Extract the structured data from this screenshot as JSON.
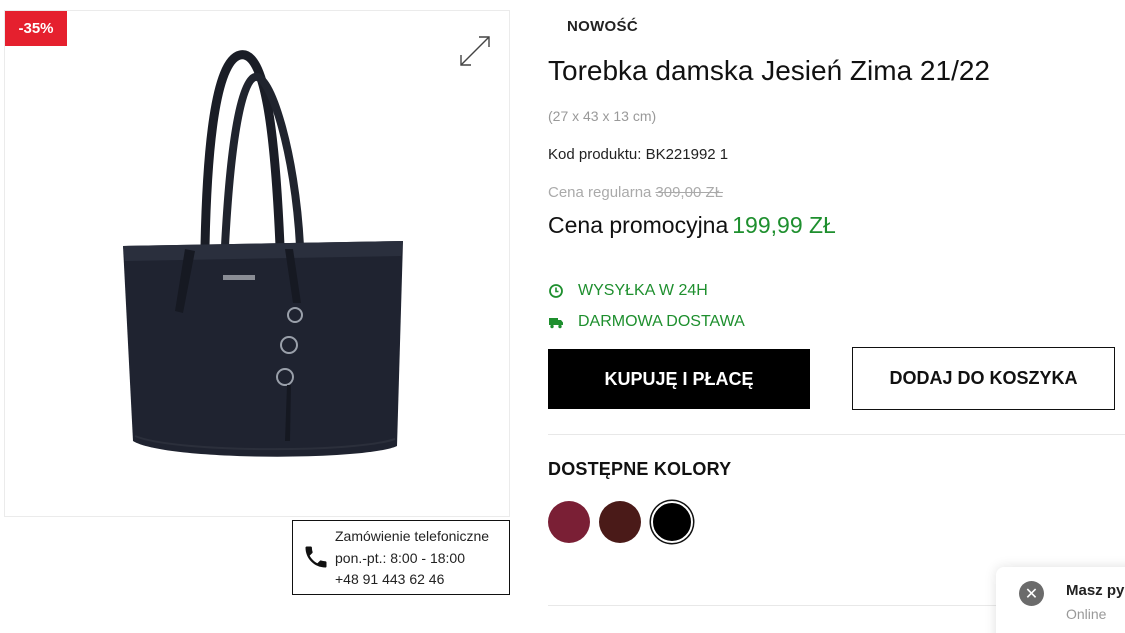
{
  "gallery": {
    "discount_badge": "-35%",
    "product_image_alt": "Torebka damska Jesień Zima 21/22",
    "expand_icon": "expand-icon"
  },
  "phone_order": {
    "icon": "phone-icon",
    "line1": "Zamówienie telefoniczne",
    "line2": "pon.-pt.: 8:00 - 18:00",
    "line3": "+48 91 443 62 46"
  },
  "product": {
    "new_label": "NOWOŚĆ",
    "title": "Torebka damska Jesień Zima 21/22",
    "dimensions": "(27 x 43 x 13 cm)",
    "code_label": "Kod produktu:",
    "code_value": "BK221992 1",
    "regular_price_label": "Cena regularna",
    "regular_price": "309,00 ZŁ",
    "promo_price_label": "Cena promocyjna",
    "promo_price": "199,99 ZŁ"
  },
  "features": [
    {
      "icon": "clock-icon",
      "label": "WYSYŁKA W 24H"
    },
    {
      "icon": "truck-icon",
      "label": "DARMOWA DOSTAWA"
    }
  ],
  "buttons": {
    "buy_now": "KUPUJĘ I PŁACĘ",
    "add_to_cart": "DODAJ DO KOSZYKA"
  },
  "colors": {
    "title": "DOSTĘPNE KOLORY",
    "swatches": [
      {
        "name": "burgundy",
        "hex": "#7a1f35"
      },
      {
        "name": "brown",
        "hex": "#4a1a18"
      },
      {
        "name": "black",
        "hex": "#000000",
        "selected": true
      }
    ]
  },
  "chat": {
    "title": "Masz py",
    "status": "Online"
  },
  "theme": {
    "accent_green": "#1e8f2e",
    "badge_red": "#e5202e"
  }
}
